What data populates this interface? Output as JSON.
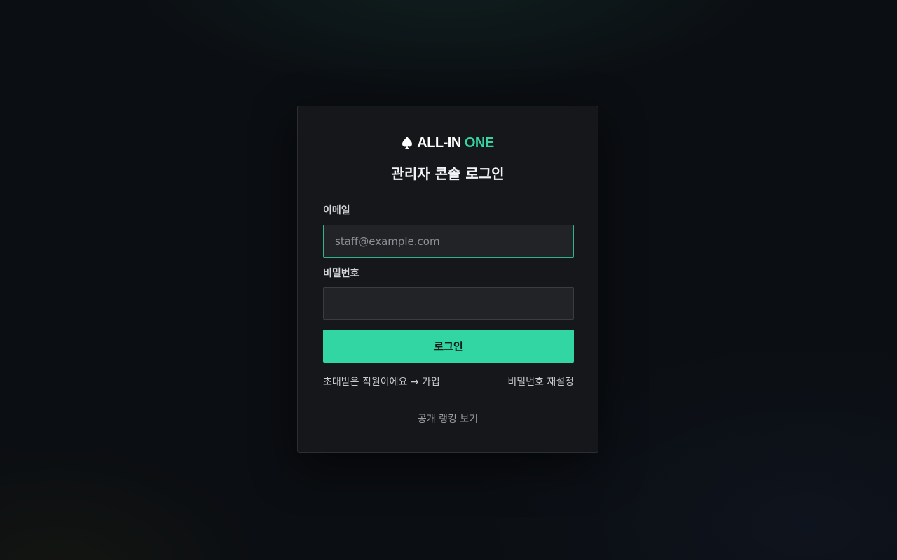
{
  "brand": {
    "name_main": "ALL-IN",
    "name_accent": "ONE",
    "accent_color": "#33d6a2",
    "icon": "spade-icon"
  },
  "page_title": "관리자 콘솔 로그인",
  "form": {
    "email": {
      "label": "이메일",
      "placeholder": "staff@example.com",
      "value": ""
    },
    "password": {
      "label": "비밀번호",
      "placeholder": "",
      "value": ""
    },
    "submit_label": "로그인"
  },
  "links": {
    "signup": "초대받은 직원이에요 → 가입",
    "reset_password": "비밀번호 재설정",
    "public_ranking": "공개 랭킹 보기"
  }
}
